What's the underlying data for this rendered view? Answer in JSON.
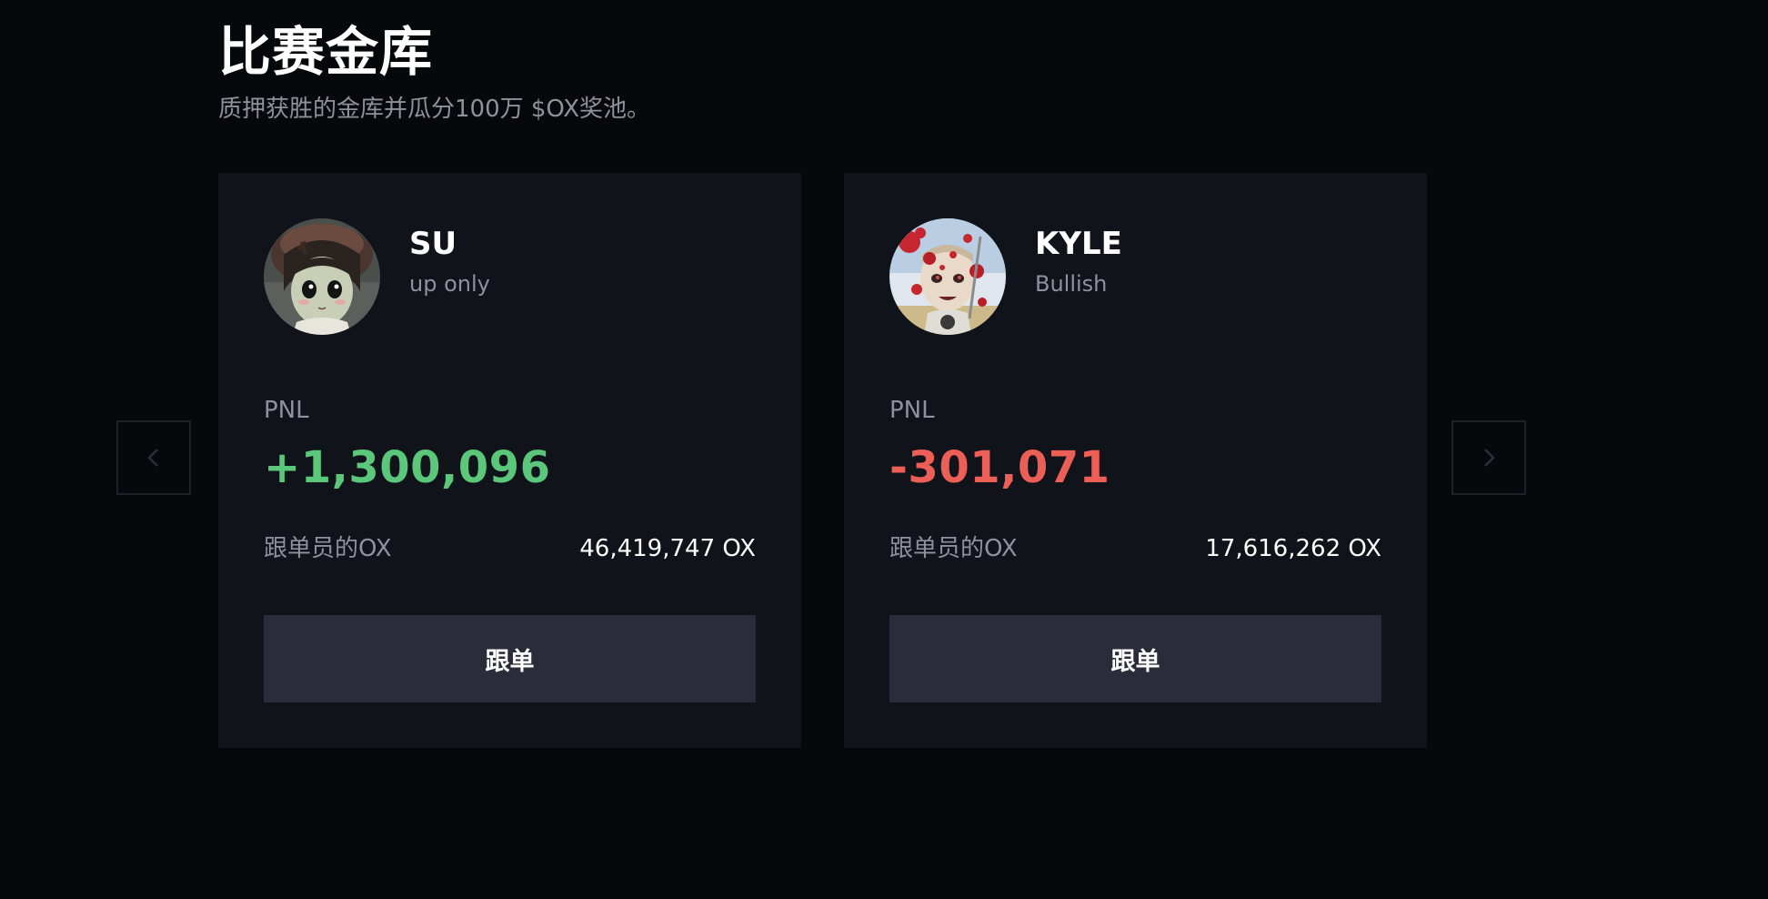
{
  "section": {
    "title": "比赛金库",
    "subtitle": "质押获胜的金库并瓜分100万 $OX奖池。"
  },
  "vaults": [
    {
      "name": "SU",
      "tagline": "up only",
      "pnl_label": "PNL",
      "pnl": "+1,300,096",
      "copiers_label": "跟单员的OX",
      "copiers_value": "46,419,747 OX",
      "button_label": "跟单",
      "avatar": "anime-girl-avatar"
    },
    {
      "name": "KYLE",
      "tagline": "Bullish",
      "pnl_label": "PNL",
      "pnl": "-301,071",
      "copiers_label": "跟单员的OX",
      "copiers_value": "17,616,262 OX",
      "button_label": "跟单",
      "avatar": "splattered-character-avatar"
    }
  ],
  "colors": {
    "background": "#07080c",
    "card": "#10131a",
    "button": "#2a2d39",
    "positive": "#5ac77a",
    "negative": "#ec5f57",
    "muted_text": "#8f929a"
  },
  "icons": {
    "prev": "chevron-left-icon",
    "next": "chevron-right-icon"
  }
}
